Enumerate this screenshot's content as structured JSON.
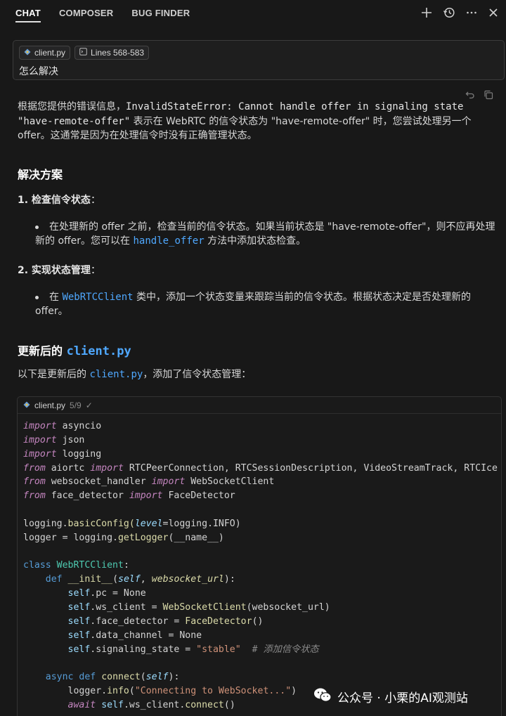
{
  "tabs": [
    {
      "label": "CHAT",
      "active": true
    },
    {
      "label": "COMPOSER",
      "active": false
    },
    {
      "label": "BUG FINDER",
      "active": false
    }
  ],
  "icons": {
    "add": "plus-icon",
    "history": "history-icon",
    "more": "more-icon",
    "close": "close-icon"
  },
  "input": {
    "chips": [
      {
        "label": "client.py",
        "icon": "python-file-icon"
      },
      {
        "label": "Lines 568-583",
        "icon": "code-lines-icon"
      }
    ],
    "query": "怎么解决"
  },
  "response": {
    "intro_a": "根据您提供的错误信息，",
    "intro_error": "InvalidStateError: Cannot handle offer in signaling state",
    "intro_state": "\"have-remote-offer\"",
    "intro_b": " 表示在 WebRTC 的信令状态为 \"have-remote-offer\" 时，您尝试处理另一个",
    "intro_c": "offer。这通常是因为在处理信令时没有正确管理状态。",
    "solution_heading": "解决方案",
    "step1_title": "1. 检查信令状态",
    "step1_colon": "：",
    "step1_bullet_a": "在处理新的 offer 之前，检查当前的信令状态。如果当前状态是 \"have-remote-offer\"，则不应再处理",
    "step1_bullet_b": "新的 offer。您可以在 ",
    "step1_code": "handle_offer",
    "step1_bullet_c": " 方法中添加状态检查。",
    "step2_title": "2. 实现状态管理",
    "step2_colon": "：",
    "step2_bullet_a": "在 ",
    "step2_code": "WebRTCClient",
    "step2_bullet_b": " 类中，添加一个状态变量来跟踪当前的信令状态。根据状态决定是否处理新的",
    "step2_bullet_c": "offer。",
    "updated_heading": "更新后的 ",
    "updated_code": "client.py",
    "updated_intro_a": "以下是更新后的 ",
    "updated_intro_code": "client.py",
    "updated_intro_b": "，添加了信令状态管理："
  },
  "codeblock": {
    "filename": "client.py",
    "count": "5/9",
    "check": "✓",
    "t": {
      "import": "import",
      "from": "from",
      "class": "class",
      "def": "def",
      "async": "async",
      "await": "await",
      "asyncio": " asyncio",
      "json": " json",
      "logging": " logging",
      "l4a": " aiortc ",
      "l4b": " RTCPeerConnection, RTCSessionDescription, VideoStreamTrack, RTCIce",
      "l5a": " websocket_handler ",
      "l5b": " WebSocketClient",
      "l6a": " face_detector ",
      "l6b": " FaceDetector",
      "l8a": "logging.",
      "l8b": "basicConfig",
      "l8c": "(",
      "l8d": "level",
      "l8e": "=logging.INFO)",
      "l9a": "logger = logging.",
      "l9b": "getLogger",
      "l9c": "(__name__)",
      "l11b": "WebRTCClient",
      "l11c": ":",
      "l12a": "    ",
      "l12b": "__init__",
      "l12c": "(",
      "l12d": "self",
      "l12e": ", ",
      "l12f": "websocket_url",
      "l12g": "):",
      "self": "self",
      "l13": ".pc = None",
      "l14a": ".ws_client = ",
      "l14b": "WebSocketClient",
      "l14c": "(websocket_url)",
      "l15a": ".face_detector = ",
      "l15b": "FaceDetector",
      "l15c": "()",
      "l16": ".data_channel = None",
      "l17a": ".signaling_state = ",
      "l17b": "\"stable\"",
      "l17c": "  # 添加信令状态",
      "l19b": "connect",
      "l19c": "(",
      "l19d": "self",
      "l19e": "):",
      "l20a": "logger.",
      "l20b": "info",
      "l20c": "(",
      "l20d": "\"Connecting to WebSocket...\"",
      "l20e": ")",
      "l21a": ".ws_client.",
      "l21b": "connect",
      "l21c": "()"
    }
  },
  "watermark": {
    "text": "公众号 · 小栗的AI观测站",
    "icon": "wechat-icon"
  }
}
